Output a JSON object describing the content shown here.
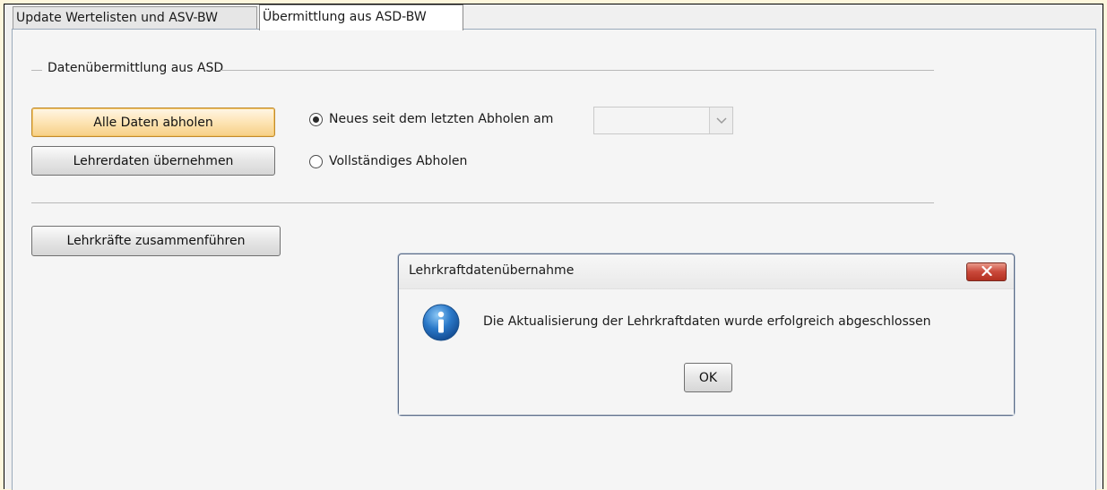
{
  "tabs": {
    "update_label": "Update Wertelisten und ASV-BW",
    "asd_label": "Übermittlung aus ASD-BW"
  },
  "section": {
    "legend": "Datenübermittlung aus ASD"
  },
  "buttons": {
    "alle_daten": "Alle Daten abholen",
    "lehrerdaten": "Lehrerdaten übernehmen",
    "zusammenfuehren": "Lehrkräfte zusammenführen"
  },
  "options": {
    "neues_label": "Neues seit dem letzten Abholen am",
    "neues_selected": true,
    "vollstaendig_label": "Vollständiges Abholen",
    "vollstaendig_selected": false,
    "date_value": ""
  },
  "dialog": {
    "title": "Lehrkraftdatenübernahme",
    "message": "Die Aktualisierung der Lehrkraftdaten wurde erfolgreich abgeschlossen",
    "ok_label": "OK",
    "icon": "info-icon",
    "close_icon": "close-icon"
  },
  "colors": {
    "default_button_accent": "#f6cf86",
    "close_button": "#c9483a",
    "info_icon": "#2a78c8"
  }
}
